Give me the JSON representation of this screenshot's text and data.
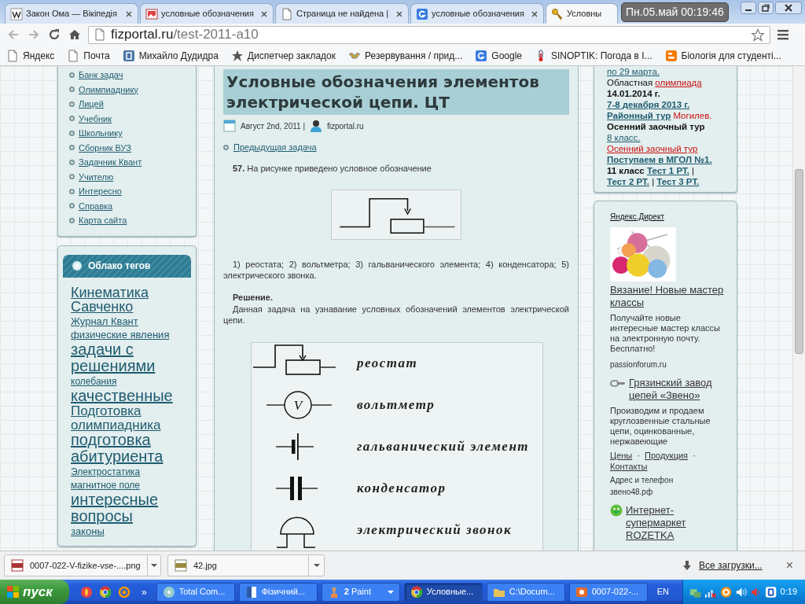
{
  "browser": {
    "tabs": [
      {
        "label": "Закон Ома — Вікіпедія",
        "selected": false
      },
      {
        "label": "условные обозначения",
        "selected": false
      },
      {
        "label": "Страница не найдена |",
        "selected": false
      },
      {
        "label": "условные обозначения",
        "selected": false
      },
      {
        "label": "Условны",
        "selected": true
      }
    ],
    "clock": "Пн.05.май 00:19:46",
    "address": {
      "host": "fizportal.ru",
      "path": "/test-2011-a10"
    },
    "bookmarks": [
      {
        "label": "Яндекс"
      },
      {
        "label": "Почта"
      },
      {
        "label": "Михайло Дудидра"
      },
      {
        "label": "Диспетчер закладок"
      },
      {
        "label": "Резервування / прид..."
      },
      {
        "label": "Google"
      },
      {
        "label": "SINOPTIK: Погода в І..."
      },
      {
        "label": "Біологія для студенті..."
      }
    ]
  },
  "left_menu": [
    "Банк задач",
    "Олимпиаднику",
    "Лицей",
    "Учебник",
    "Школьнику",
    "Сборник ВУЗ",
    "Задачник Квант",
    "Учителю",
    "Интересно",
    "Справка",
    "Карта сайта"
  ],
  "tag_cloud": {
    "title": "Облако тегов",
    "tags": [
      {
        "label": "Кинематика",
        "kind": "lg"
      },
      {
        "label": "Савченко",
        "kind": "lg"
      },
      {
        "label": "Журнал Квант",
        "kind": "sm"
      },
      {
        "label": "физические явления",
        "kind": "sm"
      },
      {
        "label": "задачи с решениями",
        "kind": "xl"
      },
      {
        "label": "колебания",
        "kind": "xs"
      },
      {
        "label": "качественные",
        "kind": "xl"
      },
      {
        "label": "Подготовка олимпиадника",
        "kind": "md"
      },
      {
        "label": "подготовка абитуриента",
        "kind": "xl"
      },
      {
        "label": "Электростатика",
        "kind": "xs"
      },
      {
        "label": "магнитное поле",
        "kind": "xs"
      },
      {
        "label": "интересные вопросы",
        "kind": "xl"
      },
      {
        "label": "законы",
        "kind": "sm"
      }
    ]
  },
  "article": {
    "title": "Условные обозначения элементов электрической цепи. ЦТ",
    "date": "Август 2nd, 2011 |",
    "author": "fizportal.ru",
    "previous": "Предыдущая задача",
    "question": "**57.** На рисунке приведено условное обозначение",
    "options": "1) реостата; 2) вольтметра; 3) гальванического элемента; 4) конденсатора; 5) электрического звонка.",
    "solution_heading": "Решение.",
    "solution": "Данная задача на узнавание условных обозначений элементов электрической цепи.",
    "figure": [
      {
        "kind": "rheostat",
        "label": "реостат"
      },
      {
        "kind": "voltmeter",
        "symbol": "V",
        "label": "вольтметр"
      },
      {
        "kind": "cell",
        "label": "гальванический элемент"
      },
      {
        "kind": "capacitor",
        "label": "конденсатор"
      },
      {
        "kind": "bell",
        "label": "электрический звонок"
      }
    ]
  },
  "news": [
    [
      {
        "kind": "link",
        "text": "по 29 марта."
      }
    ],
    [
      {
        "kind": "plain",
        "text": "Областная"
      },
      {
        "kind": "redlink",
        "text": "олимпиада"
      }
    ],
    [
      {
        "kind": "bold",
        "text": "14.01.2014 г."
      }
    ],
    [
      {
        "kind": "boldlink",
        "text": "7-8 декабря 2013 г."
      }
    ],
    [
      {
        "kind": "boldlink",
        "text": "Районный тур"
      },
      {
        "kind": "red",
        "text": "Могилев."
      }
    ],
    [
      {
        "kind": "bold",
        "text": "Осенний заочный тур"
      },
      {
        "kind": "link",
        "text": "8 класс."
      }
    ],
    [
      {
        "kind": "redlink",
        "text": "Осенний заочный тур"
      }
    ],
    [
      {
        "kind": "boldlink",
        "text": "Поступаем в МГОЛ №1."
      }
    ],
    [
      {
        "kind": "bold",
        "text": "11 класс"
      },
      {
        "kind": "boldlink",
        "text": "Тест 1 РТ."
      },
      {
        "kind": "plain",
        "text": "|"
      },
      {
        "kind": "boldlink",
        "text": "Тест 2 РТ."
      },
      {
        "kind": "plain",
        "text": "|"
      },
      {
        "kind": "boldlink",
        "text": "Тест 3 РТ."
      }
    ]
  ],
  "ads": {
    "label": "Яндекс.Директ",
    "items": [
      {
        "title": "Вязание! Новые мастер классы",
        "text": "Получайте новые интересные мастер классы на электронную почту. Бесплатно!",
        "domain": "passionforum.ru"
      },
      {
        "title": "Грязинский завод цепей «Звено»",
        "text": "Производим и продаем круглозвенные стальные цепи, оцинкованные, нержавеющие",
        "links": [
          "Цены",
          "Продукция",
          "Контакты"
        ],
        "link_separator": "·",
        "address": "Адрес и телефон",
        "domain": "звено48.рф"
      },
      {
        "title": "Интернет-супермаркет ROZETKA"
      }
    ]
  },
  "downloads": {
    "items": [
      {
        "name": "0007-022-V-fizike-vse-....png"
      },
      {
        "name": "42.jpg"
      }
    ],
    "all": "Все загрузки...",
    "close": "×"
  },
  "taskbar": {
    "start": "пуск",
    "more": "»",
    "tasks": [
      {
        "label": "Total Com...",
        "selected": false
      },
      {
        "label": "Фізичний...",
        "selected": false
      },
      {
        "label": "Paint",
        "count": "2",
        "selected": false
      },
      {
        "label": "Условные...",
        "selected": true
      },
      {
        "label": "C:\\Docum...",
        "selected": false
      },
      {
        "label": "0007-022-...",
        "selected": false
      }
    ],
    "language": "EN",
    "time": "0:19"
  }
}
